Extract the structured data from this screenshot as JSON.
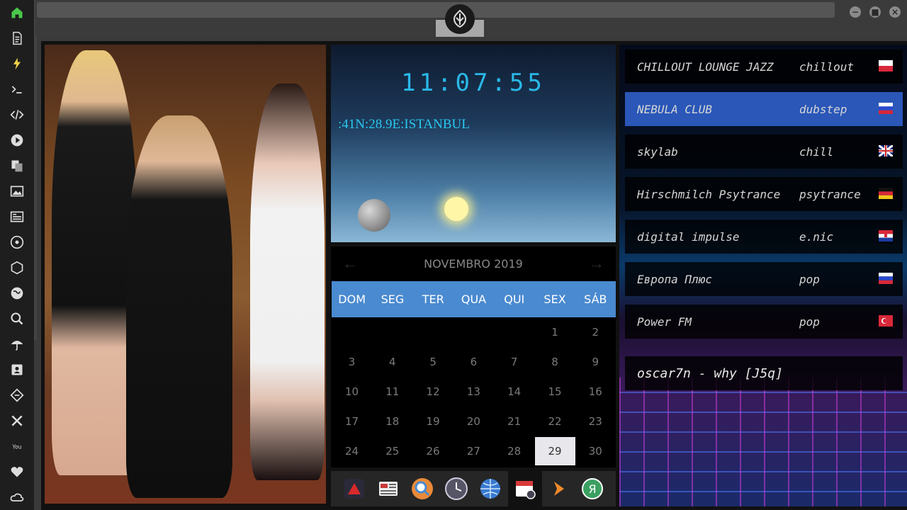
{
  "clock": {
    "time": "11:07:55",
    "location": ":41N:28.9E:ISTANBUL"
  },
  "calendar": {
    "title": "NOVEMBRO 2019",
    "prev": "←",
    "next": "→",
    "weekdays": [
      "DOM",
      "SEG",
      "TER",
      "QUA",
      "QUI",
      "SEX",
      "SÁB"
    ],
    "days": [
      "1",
      "2",
      "3",
      "4",
      "5",
      "6",
      "7",
      "8",
      "9",
      "10",
      "11",
      "12",
      "13",
      "14",
      "15",
      "16",
      "17",
      "18",
      "19",
      "20",
      "21",
      "22",
      "23",
      "24",
      "25",
      "26",
      "27",
      "28",
      "29",
      "30"
    ],
    "today": "29"
  },
  "radio": {
    "stations": [
      {
        "name": "CHILLOUT LOUNGE JAZZ",
        "genre": "chillout",
        "flag": "poland",
        "active": false
      },
      {
        "name": "NEBULA CLUB",
        "genre": "dubstep",
        "flag": "russia",
        "active": true
      },
      {
        "name": "skylab",
        "genre": "chill",
        "flag": "uk",
        "active": false
      },
      {
        "name": "Hirschmilch Psytrance",
        "genre": "psytrance",
        "flag": "germany",
        "active": false
      },
      {
        "name": "digital impulse",
        "genre": "e.nic",
        "flag": "croatia",
        "active": false
      },
      {
        "name": "Европа Плюс",
        "genre": "pop",
        "flag": "russia",
        "active": false
      },
      {
        "name": "Power FM",
        "genre": "pop",
        "flag": "turkey",
        "active": false
      }
    ],
    "now_playing": "oscar7n - why [J5q]"
  },
  "window": {
    "minimize": "−",
    "maximize": "■",
    "close": "×"
  },
  "sidebar_icons": [
    "home-icon",
    "document-icon",
    "bolt-icon",
    "terminal-icon",
    "code-icon",
    "play-icon",
    "translate-icon",
    "image-icon",
    "news-icon",
    "rebel-icon",
    "empire-icon",
    "globe-icon",
    "search-icon",
    "umbrella-icon",
    "contact-icon",
    "diamond-icon",
    "tools-icon",
    "youtube-icon",
    "heart-icon",
    "cloud-icon"
  ],
  "dock_icons": [
    "app-launcher-icon",
    "news-app-icon",
    "search-app-icon",
    "clock-app-icon",
    "globe-app-icon",
    "calendar-app-icon",
    "play-app-icon",
    "yandex-app-icon"
  ],
  "colors": {
    "accent": "#4a8ad0",
    "clock_text": "#29b8e8",
    "active_row": "#2a57b8"
  }
}
